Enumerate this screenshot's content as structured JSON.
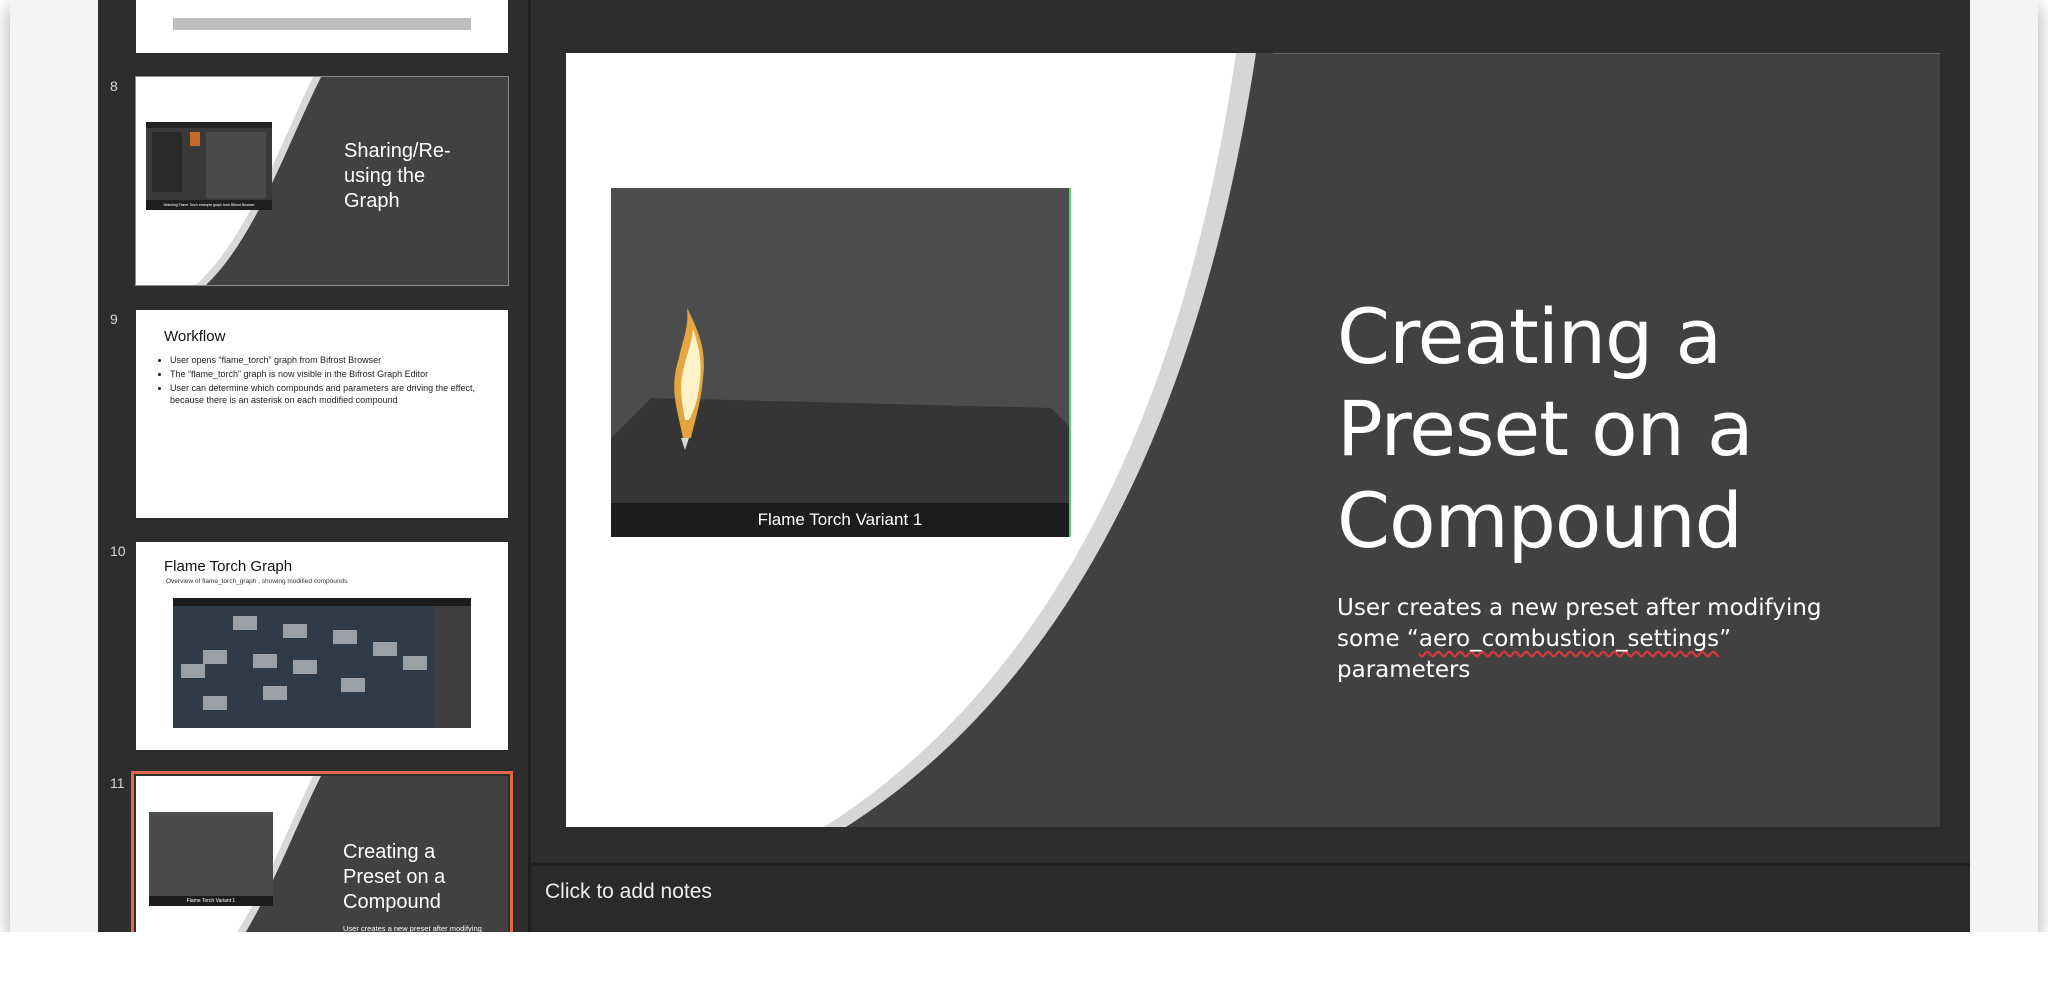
{
  "thumbnails": [
    {
      "number": "8",
      "title": "Sharing/Re-using the Graph",
      "caption": "Selecting Flame Torch example graph from Bifrost Browser"
    },
    {
      "number": "9",
      "title": "Workflow",
      "bullets": [
        "User opens “flame_torch” graph from Bifrost Browser",
        "The “flame_torch” graph is now visible in the Bifrost Graph Editor",
        "User can determine which compounds and parameters are driving the effect, because there is an asterisk on each modified compound"
      ]
    },
    {
      "number": "10",
      "title": "Flame Torch Graph",
      "subtitle": "Overview of flame_torch_graph , showing modified compounds"
    },
    {
      "number": "11",
      "title": "Creating a Preset on a Compound",
      "caption": "Flame Torch Variant 1",
      "subtitle": "User creates a new preset after modifying some “aero_combustion_settings”"
    }
  ],
  "slide": {
    "title": "Creating a Preset on a Compound",
    "subtitle_before": "User creates a new preset after modifying some “",
    "subtitle_mark": "aero_combustion_settings",
    "subtitle_after": "” parameters",
    "video_caption": "Flame Torch Variant 1"
  },
  "notes": {
    "placeholder": "Click to add notes"
  },
  "colors": {
    "slide_dark": "#414141",
    "selected_outline": "#e0674e",
    "app_bg": "#2d2d2d"
  }
}
